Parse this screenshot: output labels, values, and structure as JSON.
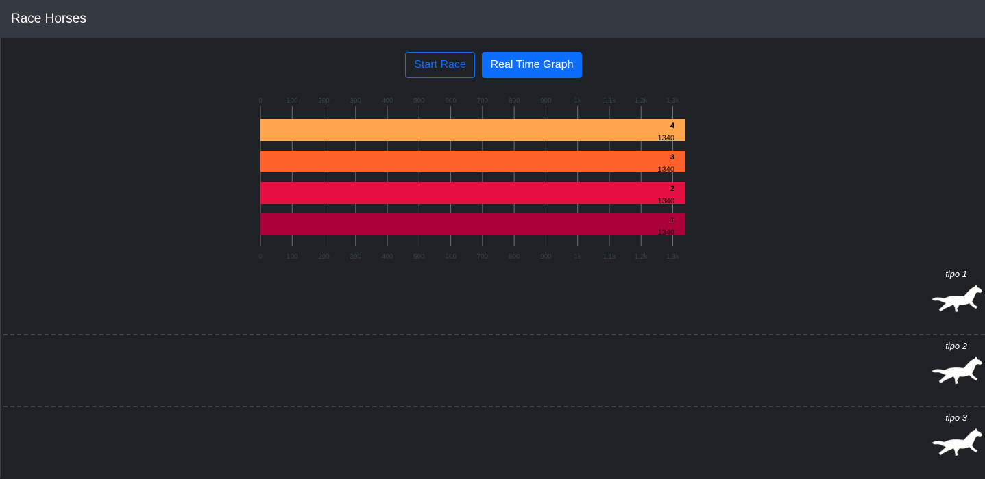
{
  "navbar": {
    "title": "Race Horses"
  },
  "controls": {
    "start_label": "Start Race",
    "graph_label": "Real Time Graph"
  },
  "chart_data": {
    "type": "bar",
    "orientation": "horizontal",
    "categories": [
      "4",
      "3",
      "2",
      "1"
    ],
    "values": [
      1340,
      1340,
      1340,
      1340
    ],
    "colors": [
      "#ffa64f",
      "#ff612a",
      "#e61042",
      "#ab003a"
    ],
    "xlim": [
      0,
      1340
    ],
    "ticks": [
      {
        "value": 0,
        "label": "0"
      },
      {
        "value": 100,
        "label": "100"
      },
      {
        "value": 200,
        "label": "200"
      },
      {
        "value": 300,
        "label": "300"
      },
      {
        "value": 400,
        "label": "400"
      },
      {
        "value": 500,
        "label": "500"
      },
      {
        "value": 600,
        "label": "600"
      },
      {
        "value": 700,
        "label": "700"
      },
      {
        "value": 800,
        "label": "800"
      },
      {
        "value": 900,
        "label": "900"
      },
      {
        "value": 1000,
        "label": "1k"
      },
      {
        "value": 1100,
        "label": "1.1k"
      },
      {
        "value": 1200,
        "label": "1.2k"
      },
      {
        "value": 1300,
        "label": "1.3k"
      }
    ],
    "grid": true,
    "axis_position": "top-and-bottom"
  },
  "lanes": [
    {
      "label": "tipo 1",
      "icon": "horse-icon"
    },
    {
      "label": "tipo 2",
      "icon": "horse-icon"
    },
    {
      "label": "tipo 3",
      "icon": "horse-icon"
    }
  ]
}
